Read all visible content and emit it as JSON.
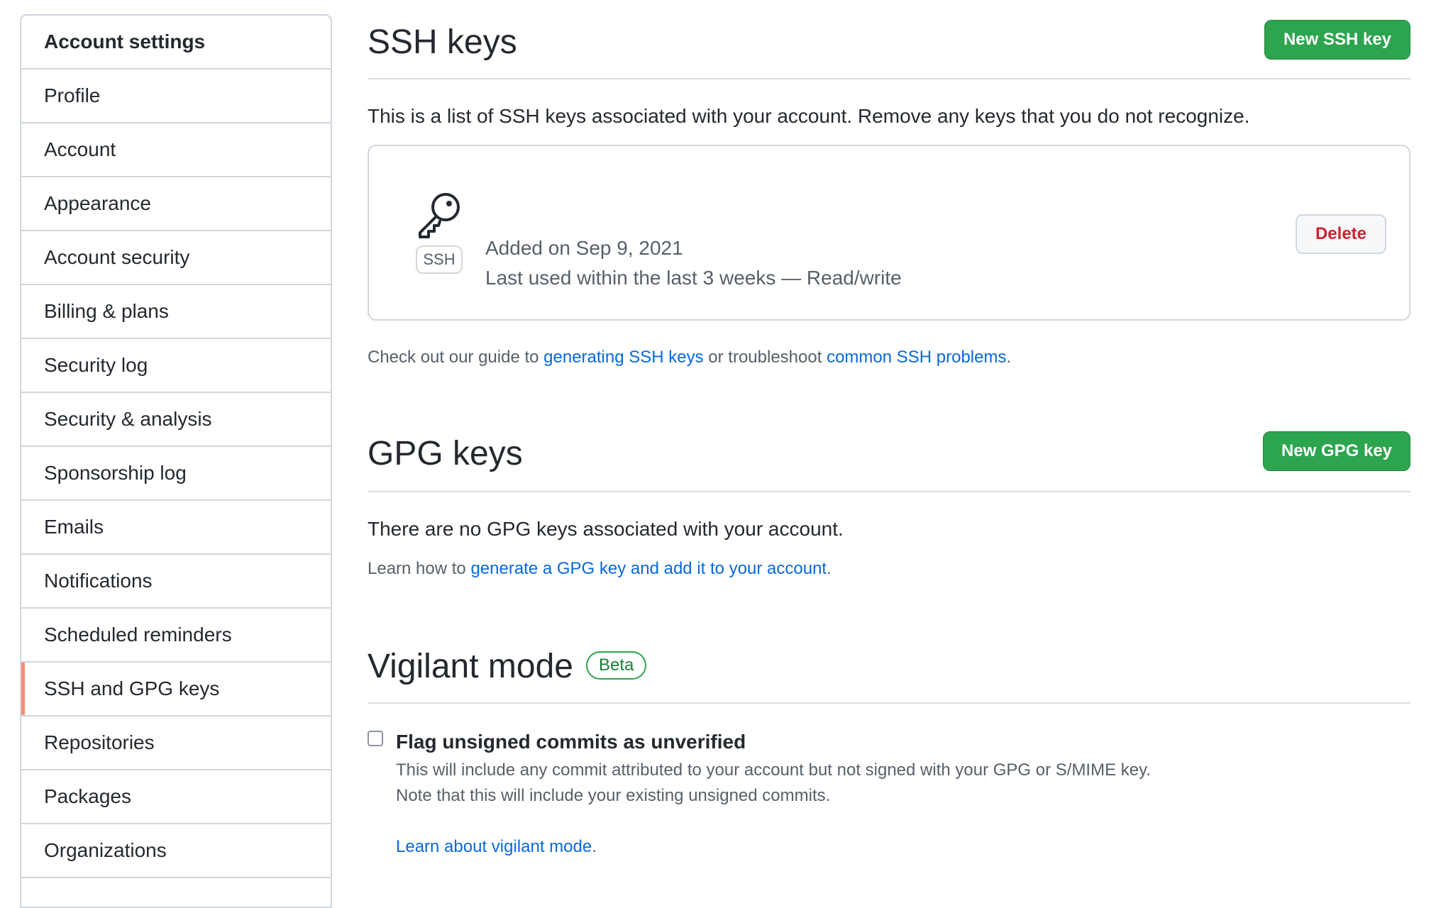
{
  "sidebar": {
    "header": "Account settings",
    "items": [
      {
        "label": "Profile"
      },
      {
        "label": "Account"
      },
      {
        "label": "Appearance"
      },
      {
        "label": "Account security"
      },
      {
        "label": "Billing & plans"
      },
      {
        "label": "Security log"
      },
      {
        "label": "Security & analysis"
      },
      {
        "label": "Sponsorship log"
      },
      {
        "label": "Emails"
      },
      {
        "label": "Notifications"
      },
      {
        "label": "Scheduled reminders"
      },
      {
        "label": "SSH and GPG keys",
        "selected": true
      },
      {
        "label": "Repositories"
      },
      {
        "label": "Packages"
      },
      {
        "label": "Organizations"
      }
    ]
  },
  "ssh": {
    "title": "SSH keys",
    "new_button": "New SSH key",
    "description": "This is a list of SSH keys associated with your account. Remove any keys that you do not recognize.",
    "key": {
      "type_label": "SSH",
      "added": "Added on Sep 9, 2021",
      "last_used": "Last used within the last 3 weeks — Read/write",
      "delete_label": "Delete"
    },
    "guide_prefix": "Check out our guide to ",
    "guide_link1": "generating SSH keys",
    "guide_middle": " or troubleshoot ",
    "guide_link2": "common SSH problems",
    "guide_suffix": "."
  },
  "gpg": {
    "title": "GPG keys",
    "new_button": "New GPG key",
    "empty_text": "There are no GPG keys associated with your account.",
    "learn_prefix": "Learn how to ",
    "learn_link": "generate a GPG key and add it to your account",
    "learn_suffix": "."
  },
  "vigilant": {
    "title": "Vigilant mode",
    "badge": "Beta",
    "checkbox_label": "Flag unsigned commits as unverified",
    "checked": false,
    "desc_line1": "This will include any commit attributed to your account but not signed with your GPG or S/MIME key.",
    "desc_line2": "Note that this will include your existing unsigned commits.",
    "learn_link": "Learn about vigilant mode",
    "learn_suffix": "."
  },
  "colors": {
    "accent_green": "#2da44e",
    "link_blue": "#0969da",
    "danger_red": "#cf222e",
    "selected_marker": "#fd8c73"
  }
}
